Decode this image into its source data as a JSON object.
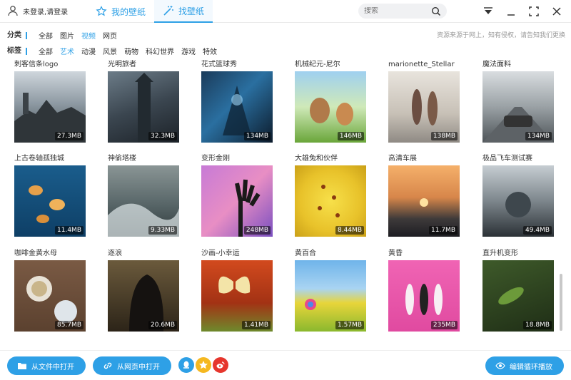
{
  "header": {
    "user_label": "未登录,请登录",
    "tabs": [
      {
        "label": "我的壁纸"
      },
      {
        "label": "找壁纸"
      }
    ],
    "search_placeholder": "搜索"
  },
  "filters": {
    "category_label": "分类",
    "categories": [
      "全部",
      "图片",
      "视频",
      "网页"
    ],
    "active_category": "视频",
    "tag_label": "标签",
    "tags": [
      "全部",
      "艺术",
      "动漫",
      "风景",
      "萌物",
      "科幻世界",
      "游戏",
      "特效"
    ],
    "active_tag": "艺术",
    "notice": "资源来源于网上，知有侵权，请告知我们更换"
  },
  "wallpapers": [
    {
      "title": "刺客信条logo",
      "size": "27.3MB"
    },
    {
      "title": "光明旅者",
      "size": "32.3MB"
    },
    {
      "title": "花式篮球秀",
      "size": "134MB"
    },
    {
      "title": "机械纪元-尼尔",
      "size": "146MB"
    },
    {
      "title": "marionette_Stellar",
      "size": "138MB"
    },
    {
      "title": "魔法面料",
      "size": "134MB"
    },
    {
      "title": "上古卷轴孤独城",
      "size": "11.4MB"
    },
    {
      "title": "神偷塔楼",
      "size": "9.33MB"
    },
    {
      "title": "变形金刚",
      "size": "248MB"
    },
    {
      "title": "大雄兔和伙伴",
      "size": "8.44MB"
    },
    {
      "title": "高清车展",
      "size": "11.7MB"
    },
    {
      "title": "极品飞车测试赛",
      "size": "49.4MB"
    },
    {
      "title": "咖啡金黄水母",
      "size": "85.7MB"
    },
    {
      "title": "逐浪",
      "size": "20.6MB"
    },
    {
      "title": "沙画-小幸运",
      "size": "1.41MB"
    },
    {
      "title": "黄百合",
      "size": "1.57MB"
    },
    {
      "title": "黄昏",
      "size": "235MB"
    },
    {
      "title": "直升机变形",
      "size": "18.8MB"
    }
  ],
  "footer": {
    "open_file_label": "从文件中打开",
    "open_web_label": "从网页中打开",
    "edit_loop_label": "编辑循环播放"
  },
  "colors": {
    "accent": "#2ea0e6"
  }
}
